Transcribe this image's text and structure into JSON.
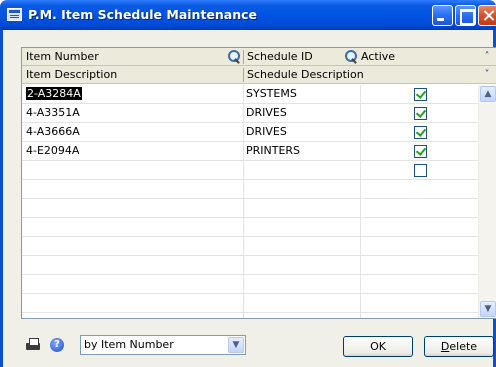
{
  "window": {
    "title": "P.M. Item Schedule Maintenance"
  },
  "grid": {
    "header1": {
      "item_number": "Item Number",
      "schedule_id": "Schedule ID",
      "active": "Active"
    },
    "header2": {
      "item_description": "Item Description",
      "schedule_description": "Schedule Description"
    },
    "rows": [
      {
        "item_number": "2-A3284A",
        "schedule": "SYSTEMS",
        "active": true
      },
      {
        "item_number": "4-A3351A",
        "schedule": "DRIVES",
        "active": true
      },
      {
        "item_number": "4-A3666A",
        "schedule": "DRIVES",
        "active": true
      },
      {
        "item_number": "4-E2094A",
        "schedule": "PRINTERS",
        "active": true
      },
      {
        "item_number": "",
        "schedule": "",
        "active": false
      }
    ]
  },
  "sort": {
    "selected": "by Item Number"
  },
  "buttons": {
    "ok": "OK",
    "delete_first": "D",
    "delete_rest": "elete"
  },
  "colors": {
    "titlebar": "#0054e3",
    "check": "#21a121"
  }
}
